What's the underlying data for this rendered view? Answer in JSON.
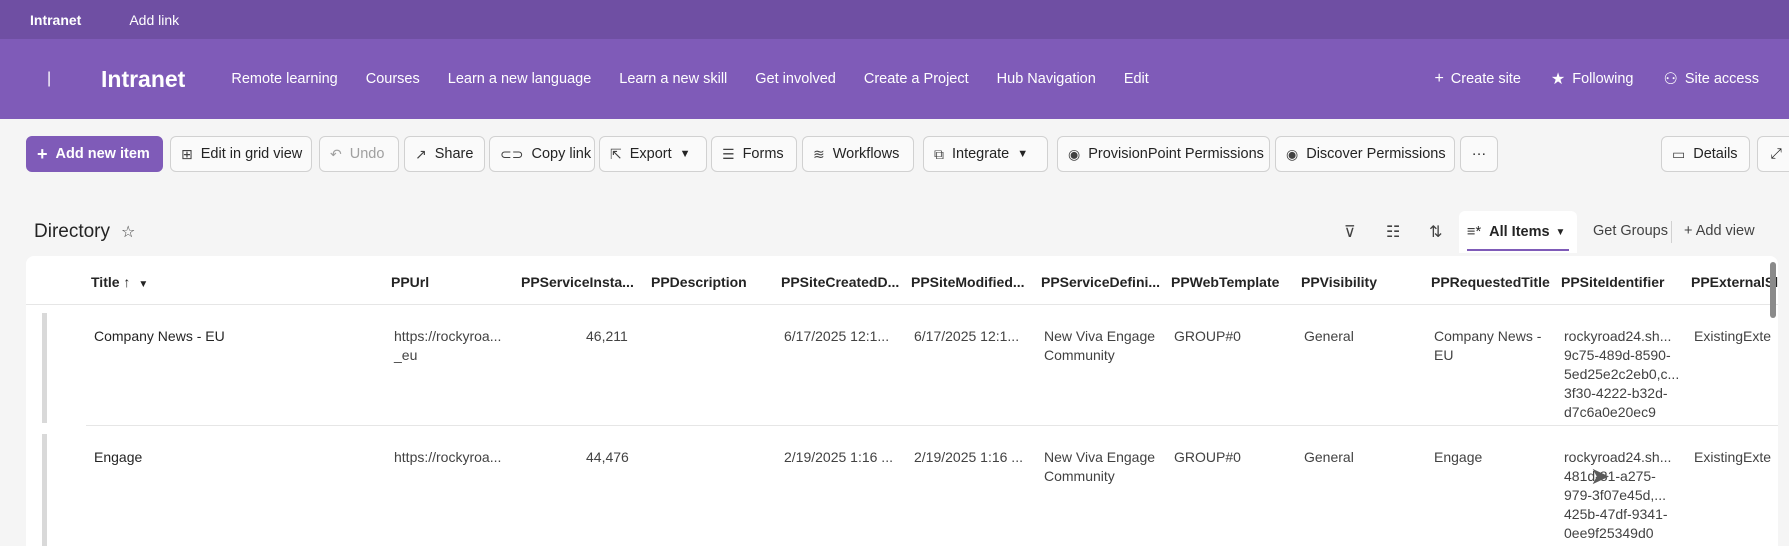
{
  "hub_bar": {
    "title": "Intranet",
    "add_link": "Add link"
  },
  "header": {
    "bar_glyph": "|",
    "site_title": "Intranet",
    "nav": [
      "Remote learning",
      "Courses",
      "Learn a new language",
      "Learn a new skill",
      "Get involved",
      "Create a Project",
      "Hub Navigation",
      "Edit"
    ],
    "create_site": "Create site",
    "following": "Following",
    "site_access": "Site access"
  },
  "commands": {
    "add_new_item": "Add new item",
    "edit_grid": "Edit in grid view",
    "undo": "Undo",
    "share": "Share",
    "copy_link": "Copy link",
    "export": "Export",
    "forms": "Forms",
    "workflows": "Workflows",
    "integrate": "Integrate",
    "provisionpoint": "ProvisionPoint Permissions",
    "discover": "Discover Permissions",
    "more": "···",
    "details": "Details"
  },
  "view": {
    "list_title": "Directory",
    "all_items": "All Items",
    "get_groups": "Get Groups",
    "add_view": "Add view"
  },
  "columns": [
    "Title ↑",
    "PPUrl",
    "PPServiceInsta...",
    "PPDescription",
    "PPSiteCreatedD...",
    "PPSiteModified...",
    "PPServiceDefini...",
    "PPWebTemplate",
    "PPVisibility",
    "PPRequestedTitle",
    "PPSiteIdentifier",
    "PPExternalSl"
  ],
  "rows": [
    {
      "title": "Company News - EU",
      "url1": "https://rockyroa...",
      "url2": "_eu",
      "instance": "46,211",
      "created": "6/17/2025 12:1...",
      "modified": "6/17/2025 12:1...",
      "def1": "New Viva Engage",
      "def2": "Community",
      "template": "GROUP#0",
      "visibility": "General",
      "req1": "Company News -",
      "req2": "EU",
      "id": [
        "rockyroad24.sh...",
        "9c75-489d-8590-",
        "5ed25e2c2eb0,c...",
        "3f30-4222-b32d-",
        "d7c6a0e20ec9"
      ],
      "external": "ExistingExte"
    },
    {
      "title": "Engage",
      "url1": "https://rockyroa...",
      "instance": "44,476",
      "created": "2/19/2025 1:16 ...",
      "modified": "2/19/2025 1:16 ...",
      "def1": "New Viva Engage",
      "def2": "Community",
      "template": "GROUP#0",
      "visibility": "General",
      "req1": "Engage",
      "id": [
        "rockyroad24.sh...",
        "481d-81-a275-",
        "979-3f07e45d,...",
        "425b-47df-9341-",
        "0ee9f25349d0"
      ],
      "external": "ExistingExte"
    }
  ]
}
